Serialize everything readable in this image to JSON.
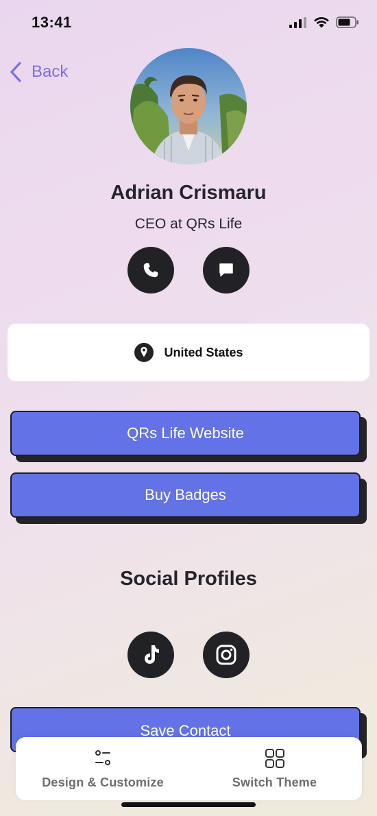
{
  "status_bar": {
    "time": "13:41"
  },
  "nav": {
    "back_label": "Back"
  },
  "profile": {
    "name": "Adrian Crismaru",
    "title": "CEO at QRs Life",
    "location": "United States"
  },
  "actions": {
    "call_icon": "phone-icon",
    "message_icon": "chat-bubble-icon"
  },
  "links": [
    {
      "label": "QRs Life Website"
    },
    {
      "label": "Buy Badges"
    }
  ],
  "social": {
    "heading": "Social Profiles",
    "items": [
      {
        "icon": "tiktok-icon"
      },
      {
        "icon": "instagram-icon"
      }
    ]
  },
  "save_contact": {
    "label": "Save Contact"
  },
  "bottom_nav": {
    "items": [
      {
        "label": "Design & Customize",
        "icon": "sliders-icon"
      },
      {
        "label": "Switch Theme",
        "icon": "grid-icon"
      }
    ]
  },
  "colors": {
    "accent": "#6372e6",
    "back_link": "#7b6fe6",
    "dark": "#222226"
  }
}
